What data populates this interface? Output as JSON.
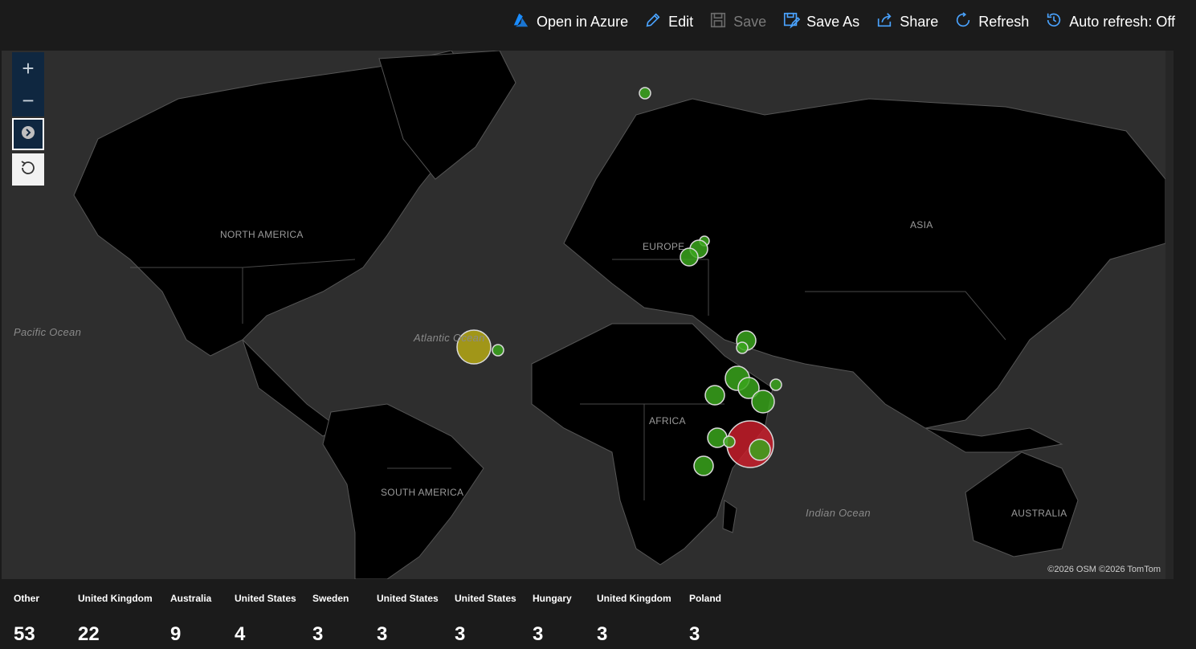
{
  "toolbar": {
    "open_in_azure": "Open in Azure",
    "edit": "Edit",
    "save": "Save",
    "save_as": "Save As",
    "share": "Share",
    "refresh": "Refresh",
    "auto_refresh": "Auto refresh: Off"
  },
  "map": {
    "labels": {
      "north_america": "NORTH AMERICA",
      "europe": "EUROPE",
      "asia": "ASIA",
      "africa": "AFRICA",
      "south_america": "SOUTH AMERICA",
      "australia": "AUSTRALIA",
      "pacific": "Pacific Ocean",
      "atlantic": "Atlantic Ocean",
      "indian": "Indian Ocean"
    },
    "attribution": "©2026 OSM  ©2026 TomTom",
    "controls": {
      "zoom_in": "+",
      "zoom_out": "−"
    },
    "colors": {
      "bubble_green": "#3aa51c",
      "bubble_yellow": "#b5a814",
      "bubble_red": "#c81e2b",
      "land": "#000000",
      "water": "#2e2e2e"
    }
  },
  "tiles": [
    {
      "label": "Other",
      "value": "53"
    },
    {
      "label": "United Kingdom",
      "value": "22"
    },
    {
      "label": "Australia",
      "value": "9"
    },
    {
      "label": "United States",
      "value": "4"
    },
    {
      "label": "Sweden",
      "value": "3"
    },
    {
      "label": "United States",
      "value": "3"
    },
    {
      "label": "United States",
      "value": "3"
    },
    {
      "label": "Hungary",
      "value": "3"
    },
    {
      "label": "United Kingdom",
      "value": "3"
    },
    {
      "label": "Poland",
      "value": "3"
    }
  ]
}
